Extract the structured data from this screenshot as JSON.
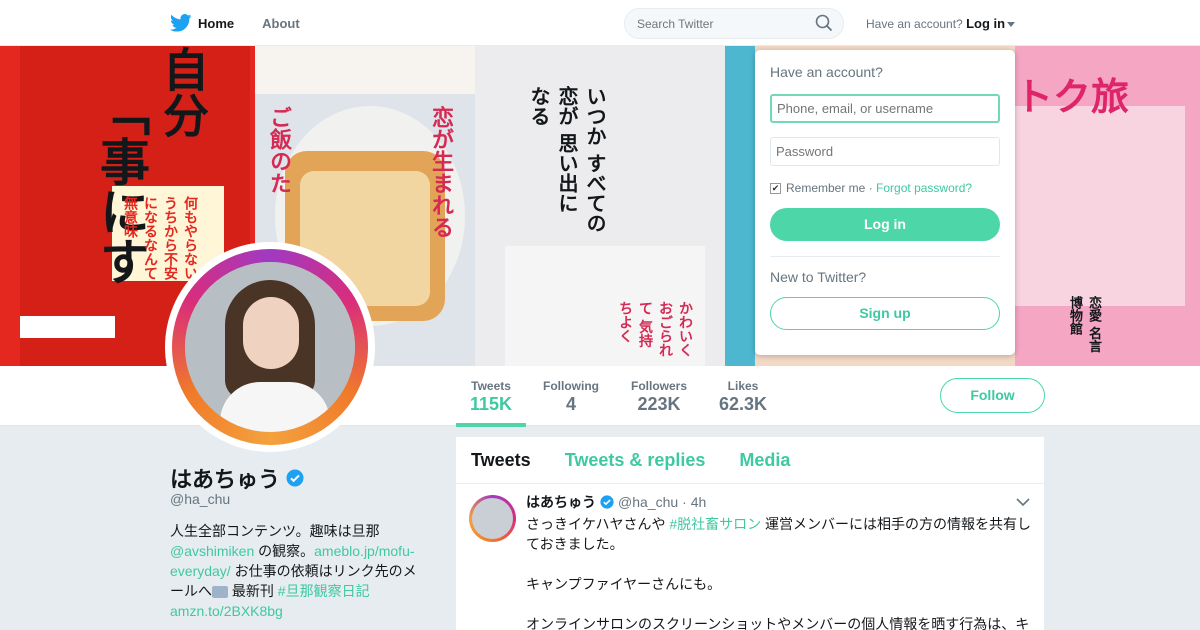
{
  "nav": {
    "home_label": "Home",
    "about_label": "About",
    "search_placeholder": "Search Twitter",
    "account_prompt": "Have an account?",
    "login_label": "Log in"
  },
  "login_panel": {
    "heading": "Have an account?",
    "username_placeholder": "Phone, email, or username",
    "password_placeholder": "Password",
    "remember_label": "Remember me",
    "separator": "·",
    "forgot_label": "Forgot password?",
    "login_button": "Log in",
    "new_prompt": "New to Twitter?",
    "signup_button": "Sign up"
  },
  "profile": {
    "name": "はあちゅう",
    "handle": "@ha_chu",
    "bio": {
      "line1": "人生全部コンテンツ。趣味は旦那",
      "mention": "@avshimiken",
      "text2": " の観察。",
      "link1": "ameblo.jp/mofu-everyday/",
      "text3": " お仕事の依頼はリンク先のメールへ",
      "text4": " 最新刊 ",
      "hashtag": "#旦那観察日記",
      "link2": "amzn.to/2BXK8bg"
    }
  },
  "stats": [
    {
      "label": "Tweets",
      "value": "115K"
    },
    {
      "label": "Following",
      "value": "4"
    },
    {
      "label": "Followers",
      "value": "223K"
    },
    {
      "label": "Likes",
      "value": "62.3K"
    }
  ],
  "follow_button": "Follow",
  "timeline": {
    "tabs": [
      "Tweets",
      "Tweets & replies",
      "Media"
    ],
    "tweet": {
      "name": "はあちゅう",
      "handle": "@ha_chu",
      "time": "· 4h",
      "text_a": "さっきイケハヤさんや ",
      "hashtag": "#脱社畜サロン",
      "text_b": " 運営メンバーには相手の方の情報を共有しておきました。",
      "para2": "キャンプファイヤーさんにも。",
      "para3": "オンラインサロンのスクリーンショットやメンバーの個人情報を晒す行為は、キ"
    }
  },
  "banner_texts": {
    "b1_title": "自分",
    "b1_title2": "「事にす",
    "b1_sub": "何もやらない うちから不安 になるなんて 無意味",
    "b2_title": "恋が生まれる",
    "b2_title2": "ご飯のた",
    "b3_title": "いつか すべての 恋が 思い出に なる",
    "b3_small": "かわいく おごられて 気持ちよく",
    "b5_title": "トク旅",
    "b5_small": "恋愛 名言 博物館"
  },
  "colors": {
    "accent": "#4dd6a8",
    "link": "#3ec9a1",
    "verified": "#1da1f2"
  }
}
